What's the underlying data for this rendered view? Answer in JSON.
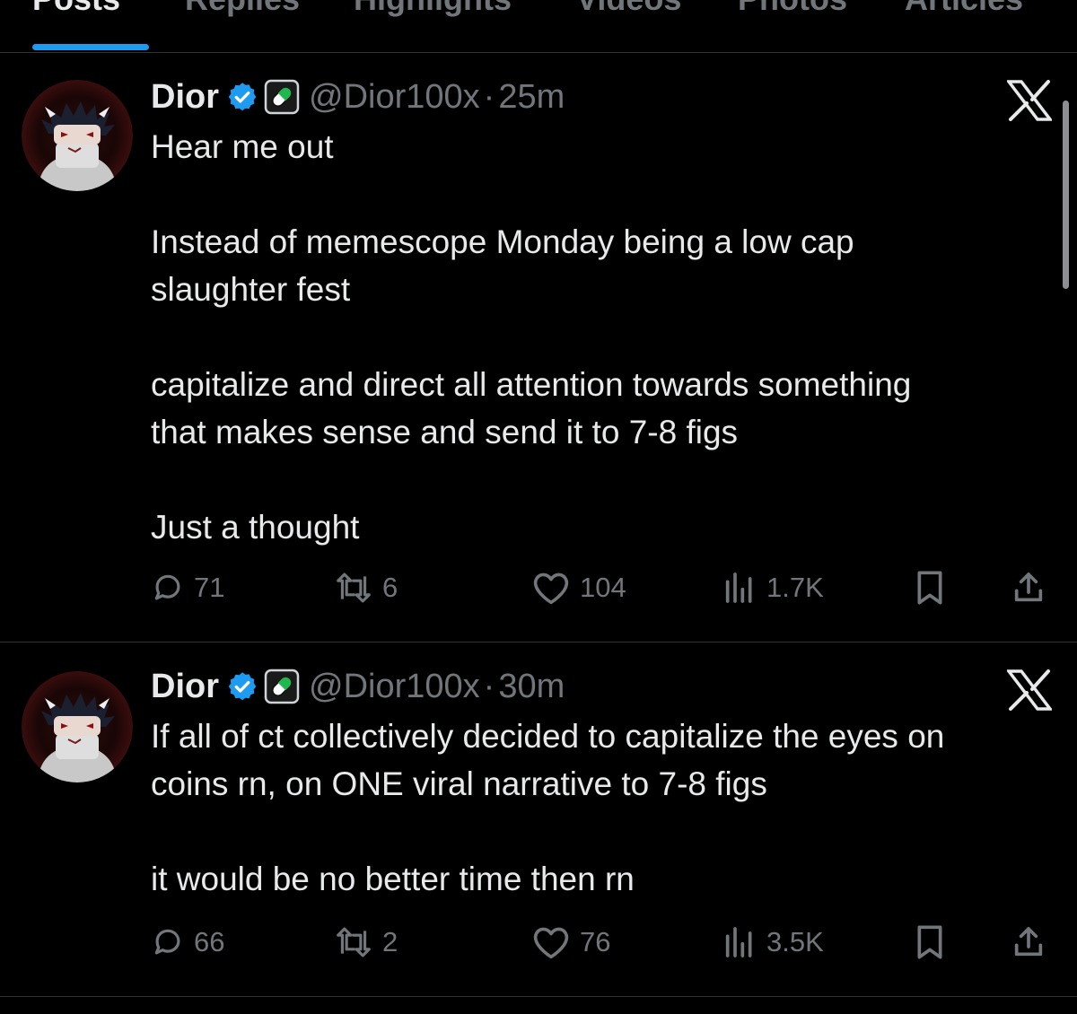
{
  "tabs": [
    {
      "label": "Posts",
      "active": true
    },
    {
      "label": "Replies",
      "active": false
    },
    {
      "label": "Highlights",
      "active": false
    },
    {
      "label": "Videos",
      "active": false
    },
    {
      "label": "Photos",
      "active": false
    },
    {
      "label": "Articles",
      "active": false
    }
  ],
  "colors": {
    "background": "#000000",
    "text": "#e7e9ea",
    "muted": "#71767b",
    "accent": "#1d9bf0",
    "verified": "#1d9bf0",
    "divider": "#2f3336"
  },
  "tweets": [
    {
      "author": {
        "name": "Dior",
        "handle": "@Dior100x",
        "verified_icon": "verified-badge-icon",
        "affiliate_icon": "pill-icon"
      },
      "separator": "·",
      "time": "25m",
      "platform_icon": "x-logo-icon",
      "lines": [
        "Hear me out",
        "",
        "Instead of memescope Monday being a low cap",
        "slaughter fest",
        "",
        "capitalize and direct all attention towards something",
        "that makes sense and send it to 7-8 figs",
        "",
        "Just a thought"
      ],
      "stats": {
        "replies": "71",
        "reposts": "6",
        "likes": "104",
        "views": "1.7K"
      }
    },
    {
      "author": {
        "name": "Dior",
        "handle": "@Dior100x",
        "verified_icon": "verified-badge-icon",
        "affiliate_icon": "pill-icon"
      },
      "separator": "·",
      "time": "30m",
      "platform_icon": "x-logo-icon",
      "lines": [
        "If all of ct collectively decided to capitalize the eyes on",
        "coins rn, on ONE viral narrative to 7-8 figs",
        "",
        "it would be no better time then rn"
      ],
      "stats": {
        "replies": "66",
        "reposts": "2",
        "likes": "76",
        "views": "3.5K"
      }
    }
  ]
}
